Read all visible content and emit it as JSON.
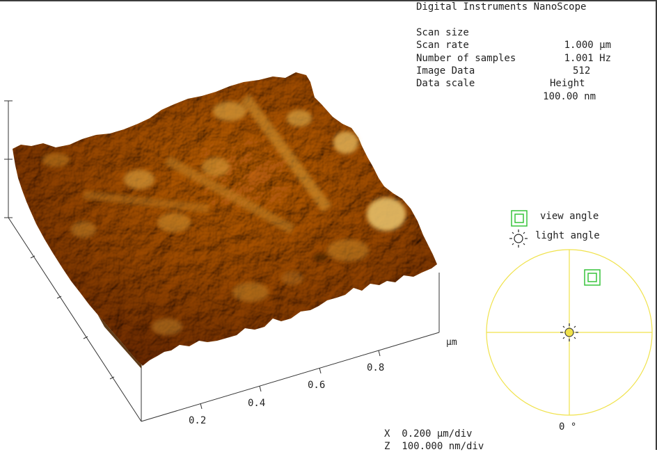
{
  "header": {
    "instrument": "Digital Instruments NanoScope",
    "rows": [
      {
        "label": "Scan size",
        "value": "1.000 µm"
      },
      {
        "label": "Scan rate",
        "value": "1.001 Hz"
      },
      {
        "label": "Number of samples",
        "value": "512"
      },
      {
        "label": "Image Data",
        "value": "Height"
      },
      {
        "label": "Data scale",
        "value": "100.00 nm"
      }
    ]
  },
  "axis": {
    "unit": "µm",
    "ticks": [
      "0.2",
      "0.4",
      "0.6",
      "0.8"
    ]
  },
  "legend": {
    "view_angle": "view angle",
    "light_angle": "light angle",
    "rotation": "0 °"
  },
  "footer": {
    "x_scale": "X  0.200 µm/div",
    "z_scale": "Z  100.000 nm/div"
  },
  "colors": {
    "surface_dark": "#5a2c00",
    "surface_mid": "#a0630f",
    "surface_light": "#f0d48a",
    "dial": "#f0e24a",
    "view_marker": "#37c43a"
  }
}
